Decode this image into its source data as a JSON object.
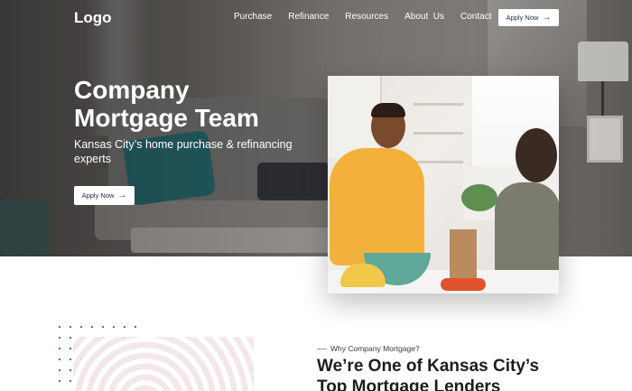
{
  "header": {
    "logo": "Logo",
    "nav": [
      {
        "label": "Purchase"
      },
      {
        "label": "Refinance"
      },
      {
        "label": "Resources"
      },
      {
        "label": "About  Us"
      },
      {
        "label": "Contact"
      }
    ],
    "apply_label": "Apply Now"
  },
  "hero": {
    "title_line1": "Company",
    "title_line2": "Mortgage Team",
    "subtitle": "Kansas City’s home purchase & refinancing experts",
    "apply_label": "Apply Now"
  },
  "icons": {
    "arrow": "arrow-right-icon"
  },
  "section": {
    "eyebrow": "Why Company Mortgage?",
    "title_line1": "We’re One of Kansas City’s",
    "title_line2": "Top Mortgage Lenders"
  },
  "colors": {
    "button_text": "#1e2a4a",
    "heading": "#1c1c1c"
  }
}
